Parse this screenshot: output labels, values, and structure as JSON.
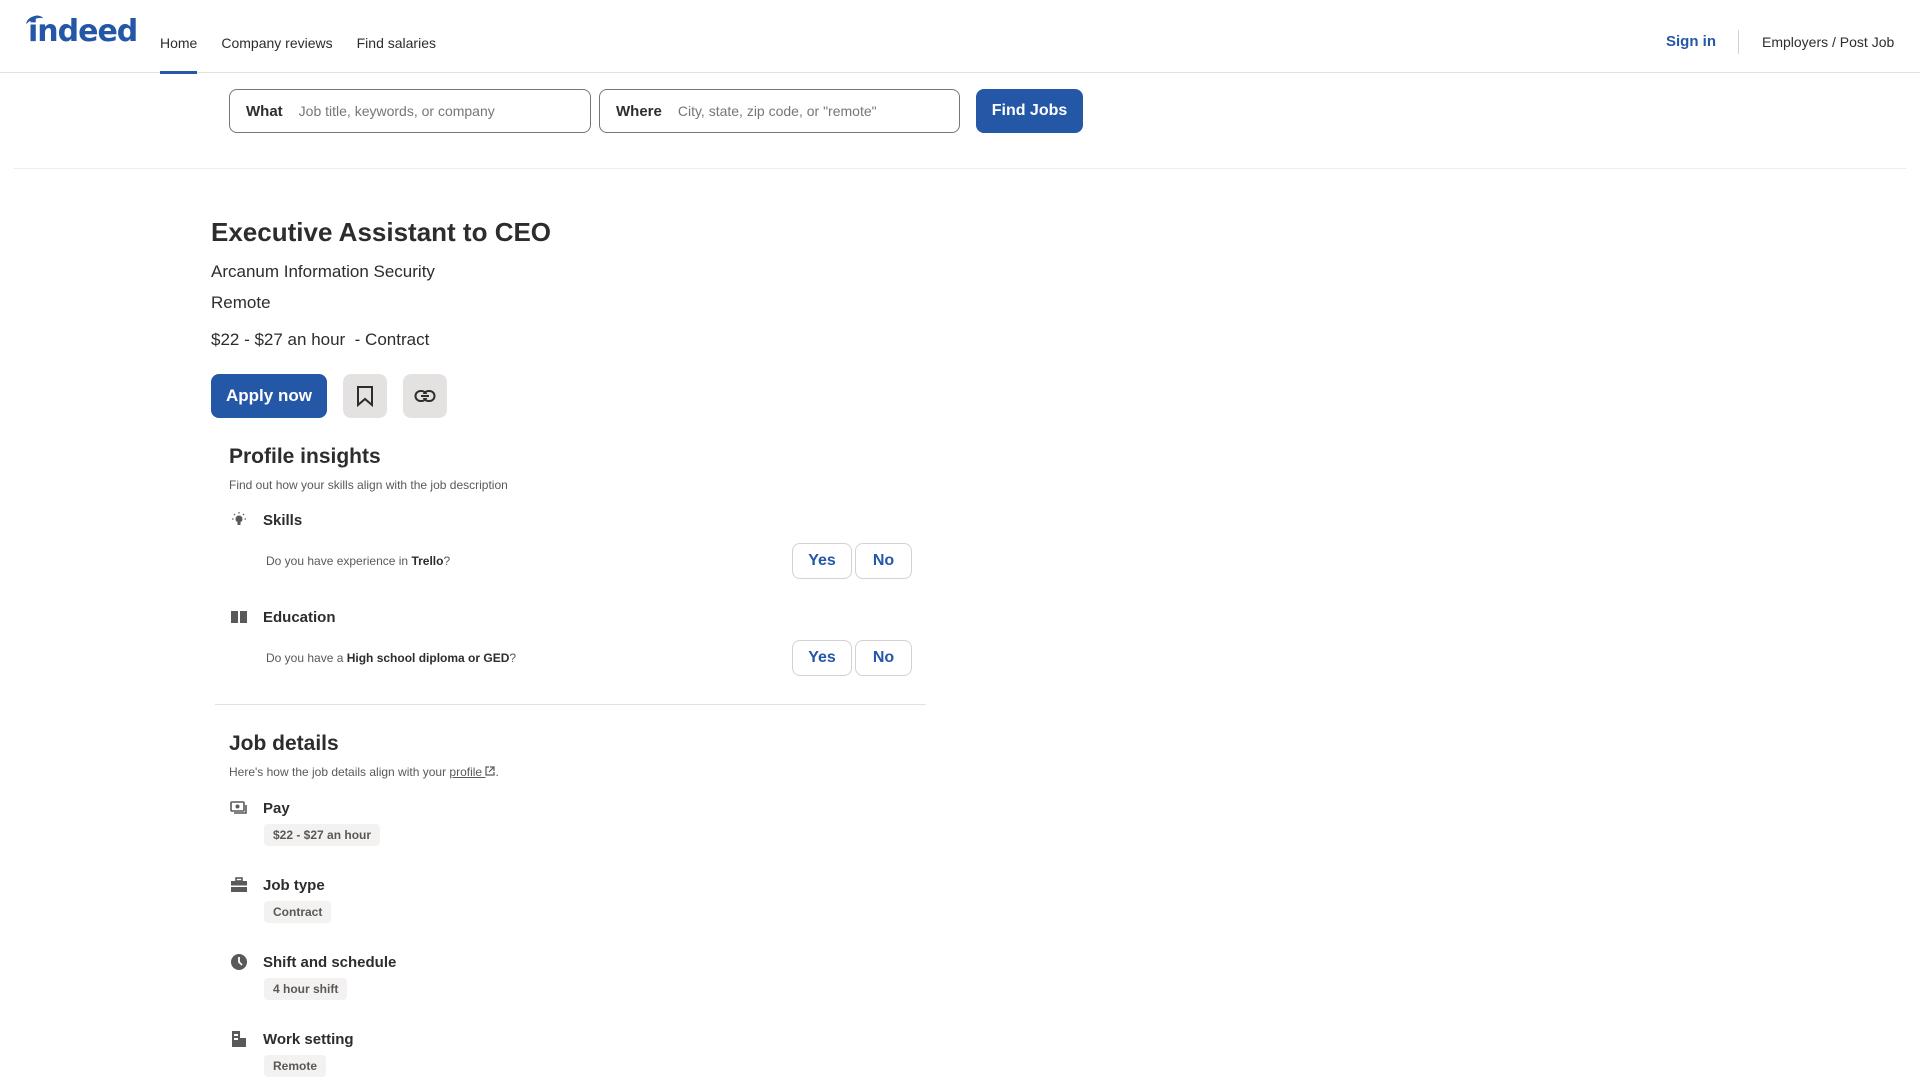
{
  "header": {
    "logo": "indeed",
    "nav": [
      {
        "label": "Home",
        "active": true
      },
      {
        "label": "Company reviews",
        "active": false
      },
      {
        "label": "Find salaries",
        "active": false
      }
    ],
    "sign_in": "Sign in",
    "employers": "Employers / Post Job"
  },
  "search": {
    "what_label": "What",
    "what_placeholder": "Job title, keywords, or company",
    "what_value": "",
    "where_label": "Where",
    "where_placeholder": "City, state, zip code, or \"remote\"",
    "where_value": "",
    "button": "Find Jobs"
  },
  "job": {
    "title": "Executive Assistant to CEO",
    "company": "Arcanum Information Security",
    "location": "Remote",
    "salary_line": "$22 - $27 an hour  - Contract",
    "apply_label": "Apply now",
    "save_icon": "bookmark-icon",
    "share_icon": "link-icon"
  },
  "profile_insights": {
    "title": "Profile insights",
    "subtitle": "Find out how your skills align with the job description",
    "groups": [
      {
        "icon": "lightbulb-icon",
        "label": "Skills",
        "question_prefix": "Do you have experience in ",
        "question_bold": "Trello",
        "question_suffix": "?",
        "yes": "Yes",
        "no": "No"
      },
      {
        "icon": "book-icon",
        "label": "Education",
        "question_prefix": "Do you have a ",
        "question_bold": "High school diploma or GED",
        "question_suffix": "?",
        "yes": "Yes",
        "no": "No"
      }
    ]
  },
  "job_details": {
    "title": "Job details",
    "subtitle_prefix": "Here's how the job details align with your ",
    "subtitle_link": "profile",
    "subtitle_suffix": ".",
    "items": [
      {
        "icon": "money-icon",
        "label": "Pay",
        "tag": "$22 - $27 an hour"
      },
      {
        "icon": "briefcase-icon",
        "label": "Job type",
        "tag": "Contract"
      },
      {
        "icon": "clock-icon",
        "label": "Shift and schedule",
        "tag": "4 hour shift"
      },
      {
        "icon": "building-icon",
        "label": "Work setting",
        "tag": "Remote"
      }
    ]
  },
  "colors": {
    "brand": "#2557a7",
    "text": "#2d2d2d",
    "muted": "#595959",
    "tag_bg": "#f3f2f1"
  }
}
